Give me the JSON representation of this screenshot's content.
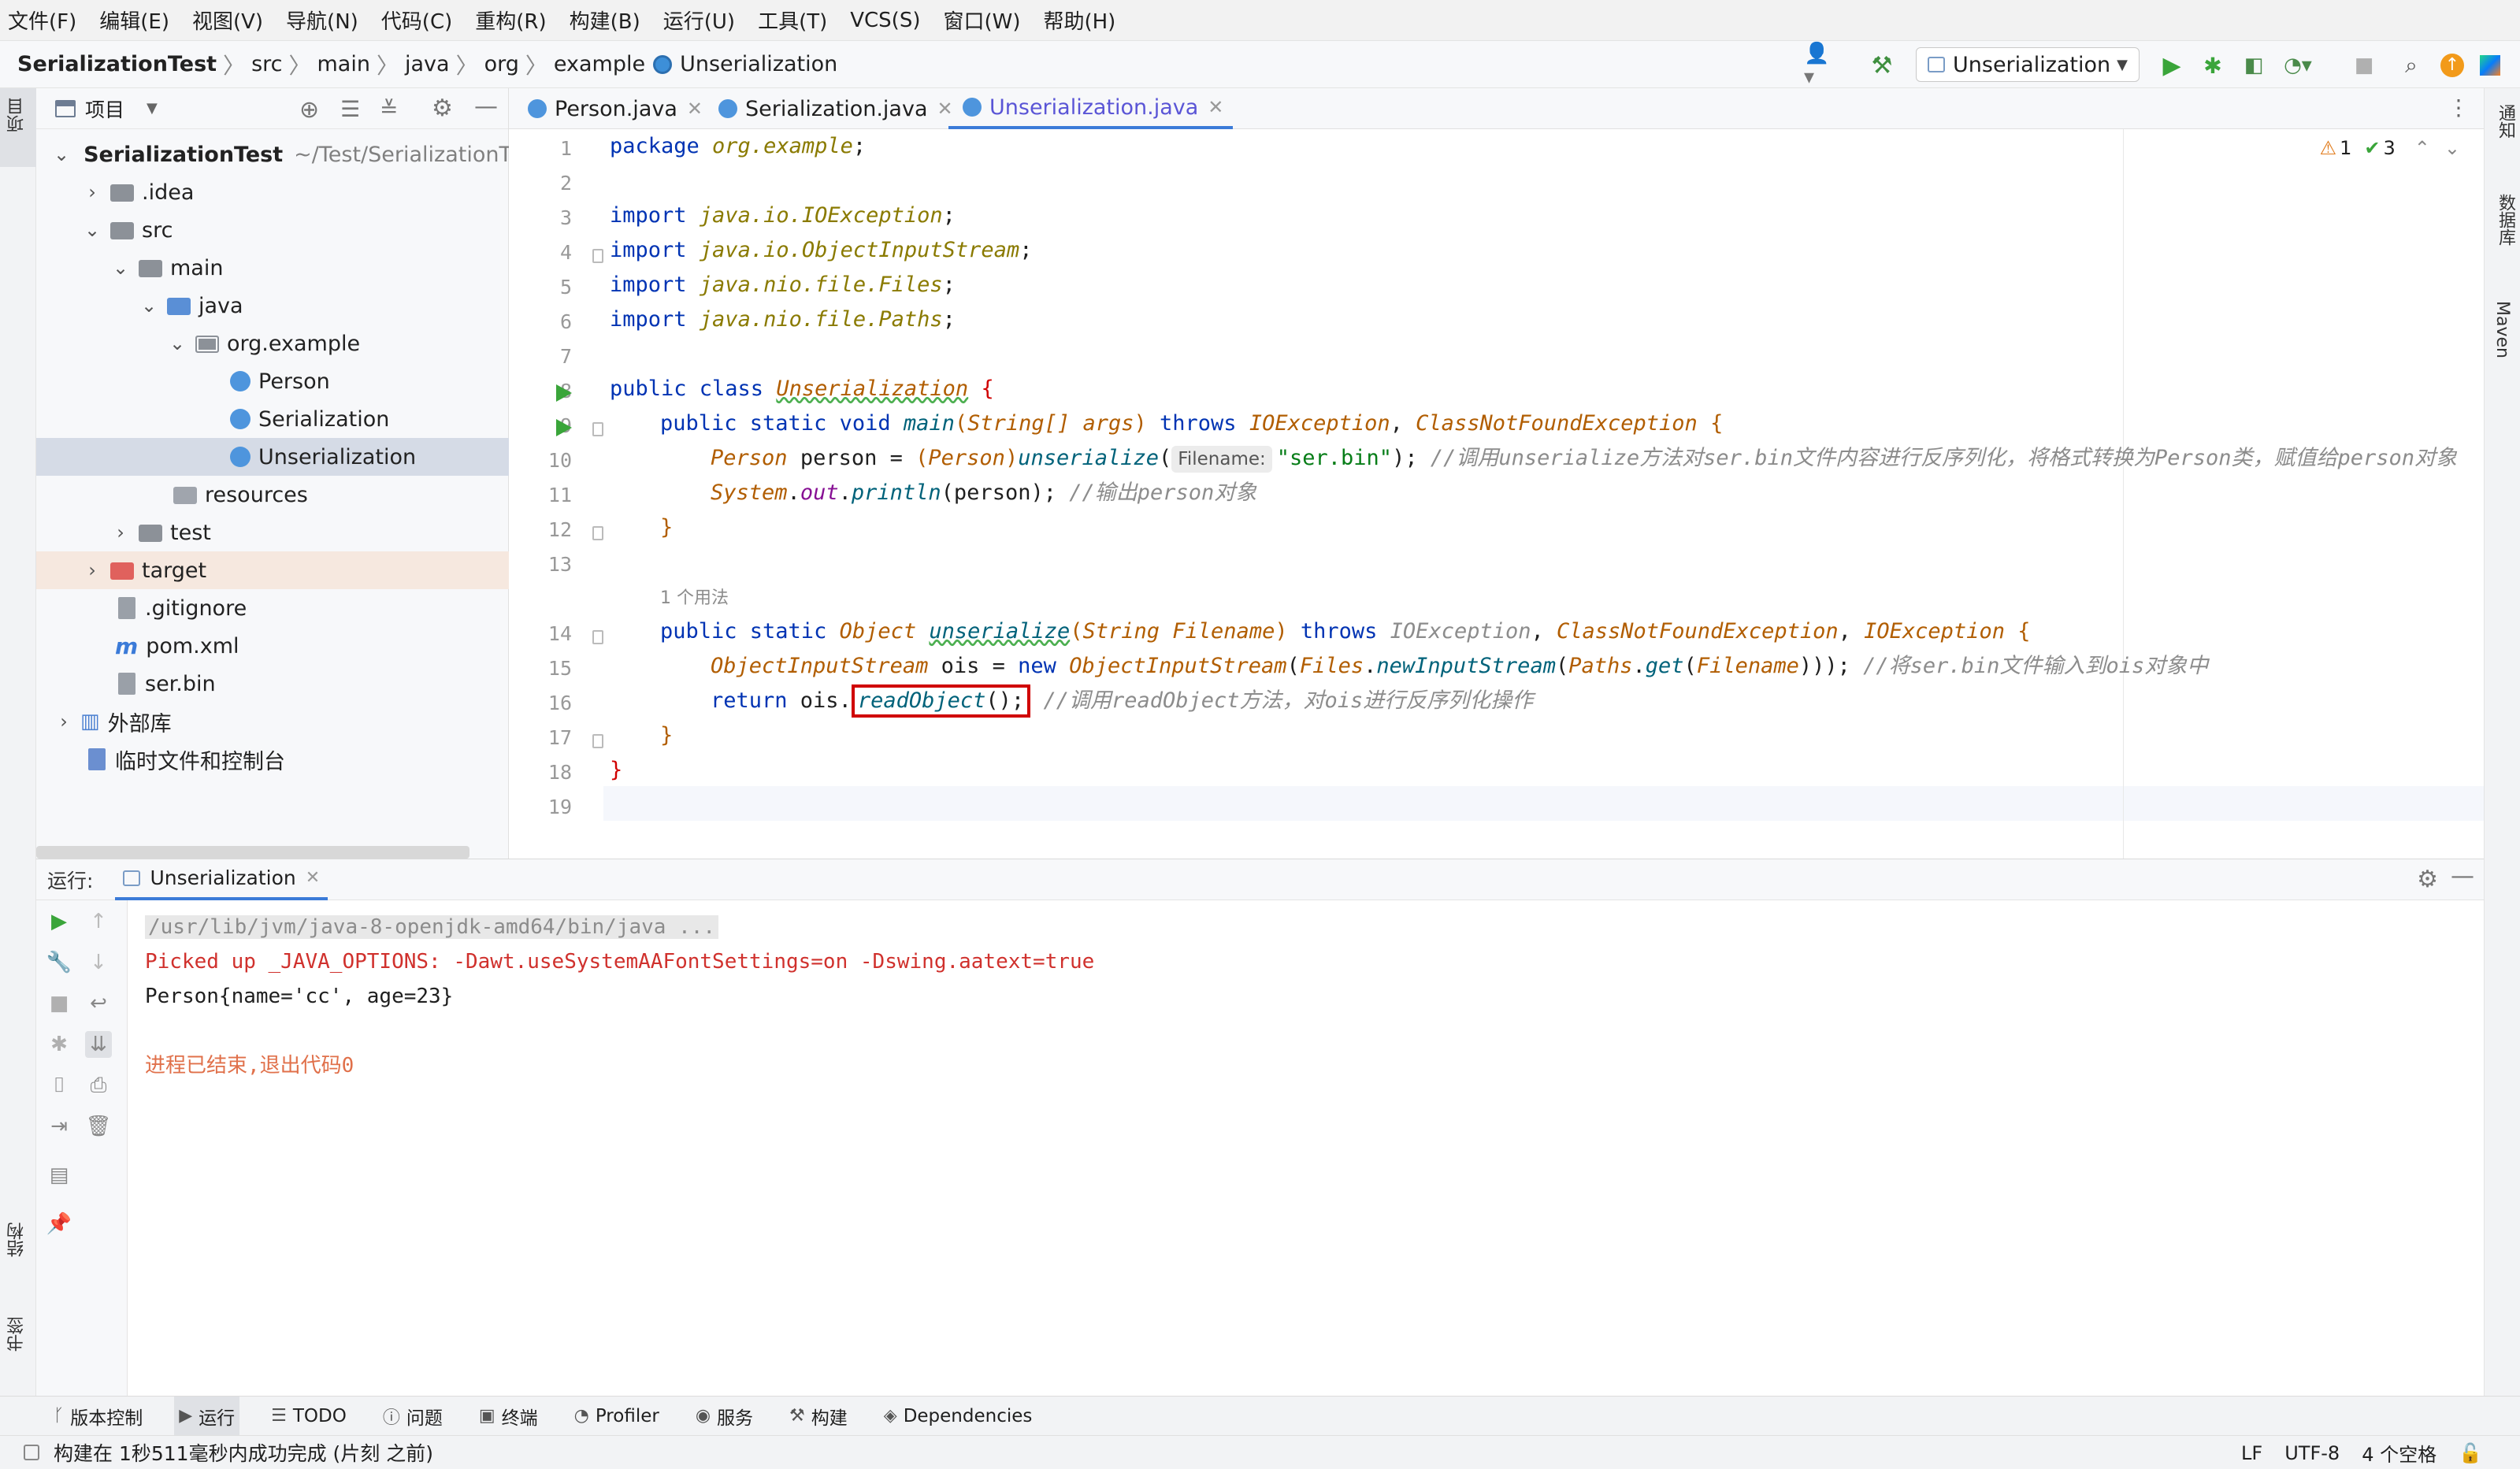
{
  "menu": [
    "文件(F)",
    "编辑(E)",
    "视图(V)",
    "导航(N)",
    "代码(C)",
    "重构(R)",
    "构建(B)",
    "运行(U)",
    "工具(T)",
    "VCS(S)",
    "窗口(W)",
    "帮助(H)"
  ],
  "breadcrumb": [
    "SerializationTest",
    "src",
    "main",
    "java",
    "org",
    "example",
    "Unserialization"
  ],
  "run_config": "Unserialization",
  "left_strip": {
    "project": "项目",
    "structure": "结构",
    "bookmarks": "书签"
  },
  "right_strip": {
    "notifications": "通知",
    "database": "数据库",
    "maven": "Maven"
  },
  "project_panel": {
    "title": "项目",
    "tree": [
      {
        "label": "SerializationTest",
        "path": "~/Test/SerializationTe",
        "kind": "root"
      },
      {
        "label": ".idea",
        "kind": "folder"
      },
      {
        "label": "src",
        "kind": "folder"
      },
      {
        "label": "main",
        "kind": "folder"
      },
      {
        "label": "java",
        "kind": "folder-blue"
      },
      {
        "label": "org.example",
        "kind": "package"
      },
      {
        "label": "Person",
        "kind": "class"
      },
      {
        "label": "Serialization",
        "kind": "class"
      },
      {
        "label": "Unserialization",
        "kind": "class"
      },
      {
        "label": "resources",
        "kind": "folder"
      },
      {
        "label": "test",
        "kind": "folder"
      },
      {
        "label": "target",
        "kind": "folder-red"
      },
      {
        "label": ".gitignore",
        "kind": "file"
      },
      {
        "label": "pom.xml",
        "kind": "maven"
      },
      {
        "label": "ser.bin",
        "kind": "file"
      },
      {
        "label": "外部库",
        "kind": "library"
      },
      {
        "label": "临时文件和控制台",
        "kind": "scratch"
      }
    ]
  },
  "editor": {
    "tabs": [
      "Person.java",
      "Serialization.java",
      "Unserialization.java"
    ],
    "active_tab": "Unserialization.java",
    "line_numbers": [
      "1",
      "2",
      "3",
      "4",
      "5",
      "6",
      "7",
      "8",
      "9",
      "10",
      "11",
      "12",
      "13",
      "14",
      "15",
      "16",
      "17",
      "18",
      "19"
    ],
    "inspections": {
      "warnings": "1",
      "ok": "3"
    },
    "usages_hint": "1 个用法",
    "param_hint": "Filename:",
    "code": {
      "l1_kw": "package ",
      "l1_pkg": "org.example",
      "imp_kw": "import ",
      "l3": "java.io.IOException",
      "l4": "java.io.ObjectInputStream",
      "l5": "java.nio.file.Files",
      "l6": "java.nio.file.Paths",
      "l8_kw": "public class ",
      "l8_name": "Unserialization",
      "l9_kw": "public static void ",
      "l9_fn": "main",
      "l9_type": "String[]",
      "l9_arg": "args",
      "l9_throws": "throws",
      "l9_ex1": "IOException",
      "l9_ex2": "ClassNotFoundException",
      "l10_type": "Person",
      "l10_var": "person",
      "l10_cast": "Person",
      "l10_fn": "unserialize",
      "l10_str": "\"ser.bin\"",
      "l10_cm": "//调用unserialize方法对ser.bin文件内容进行反序列化，将格式转换为Person类，赋值给person对象",
      "l11_cls": "System",
      "l11_out": "out",
      "l11_fn": "println",
      "l11_arg": "person",
      "l11_cm": "//输出person对象",
      "l14_kw": "public static ",
      "l14_ret": "Object",
      "l14_fn": "unserialize",
      "l14_type": "String",
      "l14_arg": "Filename",
      "l14_throws": "throws",
      "l14_ex1": "IOException",
      "l14_ex2": "ClassNotFoundException",
      "l14_ex3": "IOException",
      "l15_type": "ObjectInputStream",
      "l15_var": "ois",
      "l15_new": "new",
      "l15_ctor": "ObjectInputStream",
      "l15_files": "Files",
      "l15_fn1": "newInputStream",
      "l15_paths": "Paths",
      "l15_fn2": "get",
      "l15_arg": "Filename",
      "l15_cm": "//将ser.bin文件输入到ois对象中",
      "l16_kw": "return ",
      "l16_var": "ois",
      "l16_fn": "readObject",
      "l16_cm": "//调用readObject方法，对ois进行反序列化操作"
    }
  },
  "run_panel": {
    "label": "运行:",
    "tab": "Unserialization",
    "console": [
      "/usr/lib/jvm/java-8-openjdk-amd64/bin/java ...",
      "Picked up _JAVA_OPTIONS: -Dawt.useSystemAAFontSettings=on -Dswing.aatext=true",
      "Person{name='cc', age=23}",
      "",
      "进程已结束,退出代码0"
    ]
  },
  "bottom_tools": [
    "版本控制",
    "运行",
    "TODO",
    "问题",
    "终端",
    "Profiler",
    "服务",
    "构建",
    "Dependencies"
  ],
  "status": {
    "message": "构建在 1秒511毫秒内成功完成 (片刻 之前)",
    "line_sep": "LF",
    "encoding": "UTF-8",
    "indent": "4 个空格"
  },
  "colors": {
    "accent": "#3b7bd8",
    "run_green": "#3aa53a",
    "highlight_box": "#d00000",
    "error_text": "#d0312d"
  }
}
